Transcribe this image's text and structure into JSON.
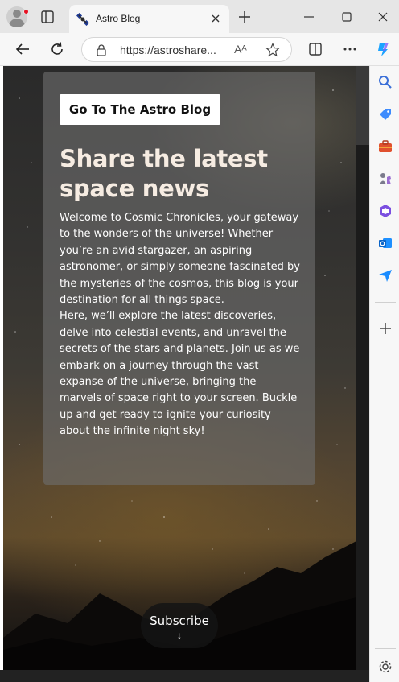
{
  "browser": {
    "tab": {
      "title": "Astro Blog"
    },
    "address": {
      "url": "https://astroshare...",
      "read_aloud": "Aᴬ"
    }
  },
  "page": {
    "cta_label": "Go To The Astro Blog",
    "title": "Share the latest space news",
    "paragraphs": [
      "Welcome to Cosmic Chronicles, your gateway to the wonders of the universe! Whether you’re an avid stargazer, an aspiring astronomer, or simply someone fascinated by the mysteries of the cosmos, this blog is your destination for all things space.",
      "Here, we’ll explore the latest discoveries, delve into celestial events, and unravel the secrets of the stars and planets. Join us as we embark on a journey through the vast expanse of the universe, bringing the marvels of space right to your screen. Buckle up and get ready to ignite your curiosity about the infinite night sky!"
    ],
    "subscribe_label": "Subscribe",
    "subscribe_arrow": "↓"
  },
  "icons": {
    "sidebar": [
      "search-icon",
      "tag-icon",
      "toolbox-icon",
      "chess-icon",
      "office-icon",
      "outlook-icon",
      "send-icon",
      "add-icon",
      "settings-icon"
    ]
  },
  "colors": {
    "card_overlay": "#6e6e6e",
    "title": "#f6ece2",
    "accent_edge": "#1a73e8"
  }
}
